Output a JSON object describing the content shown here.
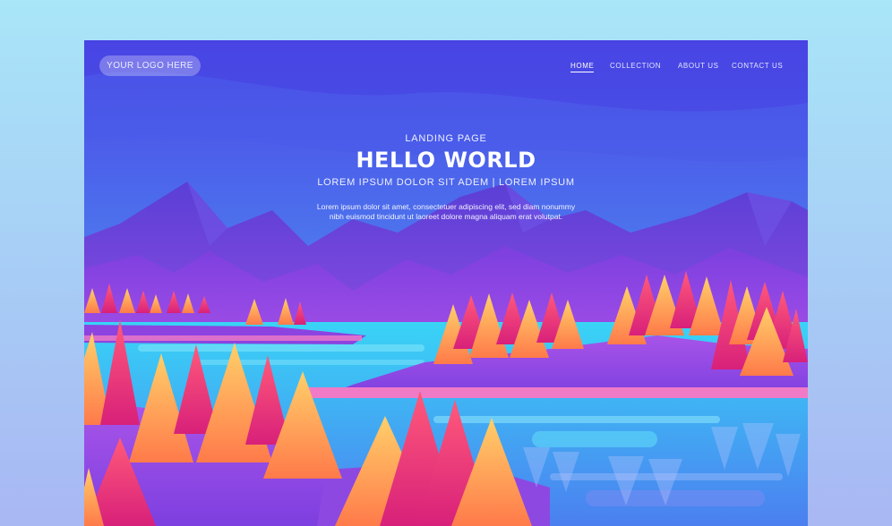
{
  "logo": {
    "text": "YOUR LOGO HERE"
  },
  "nav": {
    "items": [
      {
        "label": "HOME",
        "active": true
      },
      {
        "label": "COLLECTION",
        "active": false
      },
      {
        "label": "ABOUT US",
        "active": false
      },
      {
        "label": "CONTACT US",
        "active": false
      }
    ]
  },
  "hero": {
    "eyebrow": "LANDING PAGE",
    "title": "HELLO WORLD",
    "subtitle": "LOREM IPSUM DOLOR SIT ADEM | LOREM IPSUM",
    "body_line_1": "Lorem ipsum dolor sit amet, consectetuer adipiscing elit, sed diam nonummy",
    "body_line_2": "nibh euismod tincidunt ut laoreet dolore magna aliquam erat volutpat."
  },
  "colors": {
    "sky_top": "#4a4de6",
    "sky_bottom": "#4fb0f0",
    "mountain": "#7a4fe0",
    "lake": "#3fc6f2",
    "tree_orange": "#ffb25a",
    "tree_pink": "#f0407a"
  }
}
